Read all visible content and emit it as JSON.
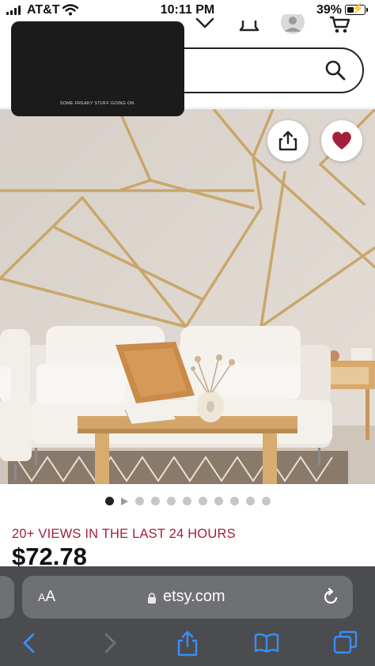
{
  "status_bar": {
    "carrier": "AT&T",
    "time": "10:11 PM",
    "battery_percent": "39%",
    "icons": [
      "signal-icon",
      "wifi-icon",
      "battery-charging-icon"
    ]
  },
  "header": {
    "icons": [
      "chevron-down-icon",
      "bell-icon",
      "avatar",
      "cart-icon"
    ],
    "search": {
      "placeholder": "",
      "icon": "search-icon"
    }
  },
  "overlay": {
    "caption": "SOME FREAKY STUFF GOING ON."
  },
  "listing": {
    "image_alt": "Geometric gold-line wallpaper behind a white sofa and wooden coffee table",
    "image_count": 11,
    "active_image_index": 0,
    "has_video": true,
    "views_text": "20+ VIEWS IN THE LAST 24 HOURS",
    "price": "$72.78",
    "favorited": true,
    "colors": {
      "favorite": "#a3203c",
      "views_text": "#a3203c"
    }
  },
  "safari": {
    "text_size_label": "AA",
    "domain": "etsy.com",
    "toolbar": [
      "back-icon",
      "forward-icon",
      "share-icon",
      "bookmarks-icon",
      "tabs-icon"
    ],
    "colors": {
      "bar": "#4b4c4f",
      "accent": "#3a8ef6"
    }
  }
}
